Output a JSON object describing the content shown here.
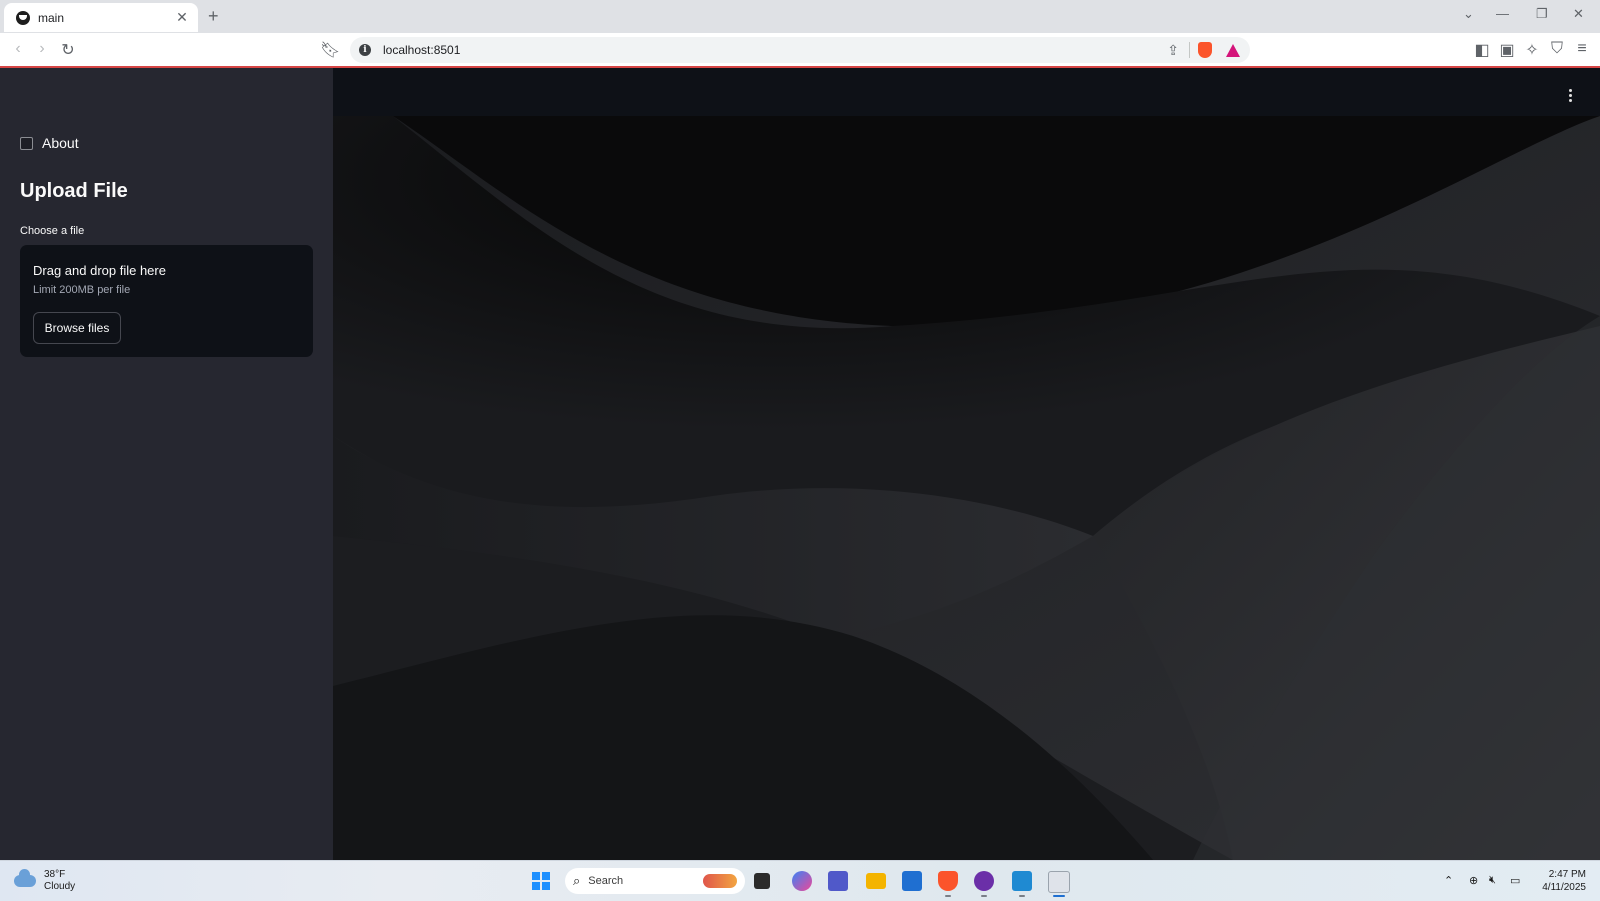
{
  "browser": {
    "tab_title": "main",
    "url": "localhost:8501"
  },
  "sidebar": {
    "about_label": "About",
    "about_checked": false,
    "upload_title": "Upload File",
    "uploader": {
      "label": "Choose a file",
      "drop_text": "Drag and drop file here",
      "limit_text": "Limit 200MB per file",
      "browse_label": "Browse files"
    }
  },
  "taskbar": {
    "weather_temp": "38°F",
    "weather_condition": "Cloudy",
    "search_placeholder": "Search",
    "time": "2:47 PM",
    "date": "4/11/2025"
  },
  "colors": {
    "sidebar_bg": "#262730",
    "main_bg": "#0e1117",
    "text": "#fafafa",
    "accent_line": "#d64545"
  },
  "icons": [
    "streamlit-favicon",
    "close-icon",
    "plus-icon",
    "chevron-down-icon",
    "minimize-icon",
    "restore-icon",
    "window-close-icon",
    "back-icon",
    "forward-icon",
    "reload-icon",
    "bookmark-icon",
    "info-icon",
    "share-icon",
    "brave-shields-icon",
    "brave-rewards-icon",
    "sidebar-toggle-icon",
    "wallet-icon",
    "leo-ai-icon",
    "vpn-icon",
    "menu-icon",
    "kebab-menu-icon",
    "weather-cloud-icon",
    "windows-start-icon",
    "search-icon"
  ]
}
